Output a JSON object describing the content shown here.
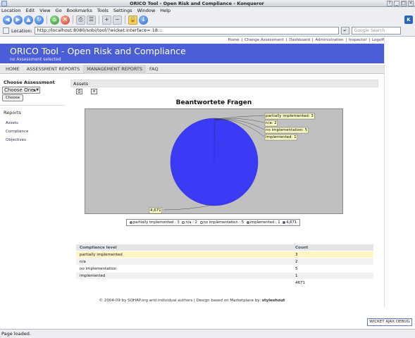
{
  "window": {
    "title": "ORICO Tool - Open Risk and Compliance - Konqueror",
    "controls": [
      "?",
      "_",
      "□",
      "×"
    ]
  },
  "menu": [
    "Location",
    "Edit",
    "View",
    "Go",
    "Bookmarks",
    "Tools",
    "Settings",
    "Window",
    "Help"
  ],
  "toolbar": {
    "icons": [
      "back-icon",
      "forward-icon",
      "up-icon",
      "reload-icon",
      "home-icon",
      "stop-icon",
      "print-icon",
      "bookmark-icon",
      "zoom-in-icon",
      "zoom-out-icon",
      "lock-icon",
      "download-icon"
    ]
  },
  "location": {
    "label": "Location:",
    "url": "http://localhost:8080/sobi/tool/?wicket:interface=:18:::",
    "search_placeholder": "Google Search"
  },
  "page": {
    "topnav": [
      "Home",
      "|",
      "Change Assessment",
      "|",
      "Dashboard",
      "|",
      "Administration",
      "|",
      "Inspector",
      "|",
      "Logoff"
    ],
    "banner_title": "ORICO Tool - Open Risk and Compliance",
    "banner_sub": "no Assessment selected",
    "mainnav": [
      "HOME",
      "ASSESSMENT REPORTS",
      "MANAGEMENT REPORTS",
      "FAQ"
    ],
    "active_tab": "MANAGEMENT REPORTS",
    "sidebar": {
      "choose_heading": "Choose Assessment",
      "select_value": "Choose One",
      "choose_button": "Choose",
      "reports_heading": "Reports",
      "links": [
        "Assets",
        "Compliance",
        "Objectives"
      ]
    },
    "panel_title": "Assets",
    "footer": {
      "text": "© 2004-09 by SOHAP.org and individual authors | Design based on Marketplace by: ",
      "credit": "styleshout"
    },
    "debug_button": "WICKET AJAX DEBUG"
  },
  "table": {
    "headers": [
      "Compliance level",
      "Count"
    ],
    "rows": [
      [
        "partially implemented",
        "3"
      ],
      [
        "n/a",
        "2"
      ],
      [
        "no implementation",
        "5"
      ],
      [
        "implemented",
        "1"
      ],
      [
        "",
        "4671"
      ]
    ]
  },
  "chart_data": {
    "type": "pie",
    "title": "Beantwortete Fragen",
    "slices": [
      {
        "label": "partially implemented",
        "value": 3,
        "tag": "partially implemented: 3",
        "color": "#2f8f2f"
      },
      {
        "label": "n/a",
        "value": 2,
        "tag": "n/a: 2",
        "color": "#f5f5b8"
      },
      {
        "label": "no implementation",
        "value": 5,
        "tag": "no implementation: 5",
        "color": "#ffffff"
      },
      {
        "label": "implemented",
        "value": 1,
        "tag": "implemented: 1",
        "color": "#333333"
      },
      {
        "label": "",
        "value": 4671,
        "tag": "4,671",
        "color": "#3b3bf5"
      }
    ],
    "legend": [
      "partially implemented : 3",
      "n/a : 2",
      "no implementation : 5",
      "implemented : 1",
      "4,671"
    ],
    "legend_colors": [
      "#8a8a8a",
      "#f5f5b8",
      "#ffffff",
      "#888888",
      "#3b3bf5"
    ],
    "legend_placement": "bottom"
  },
  "status": {
    "text": "Page loaded."
  }
}
